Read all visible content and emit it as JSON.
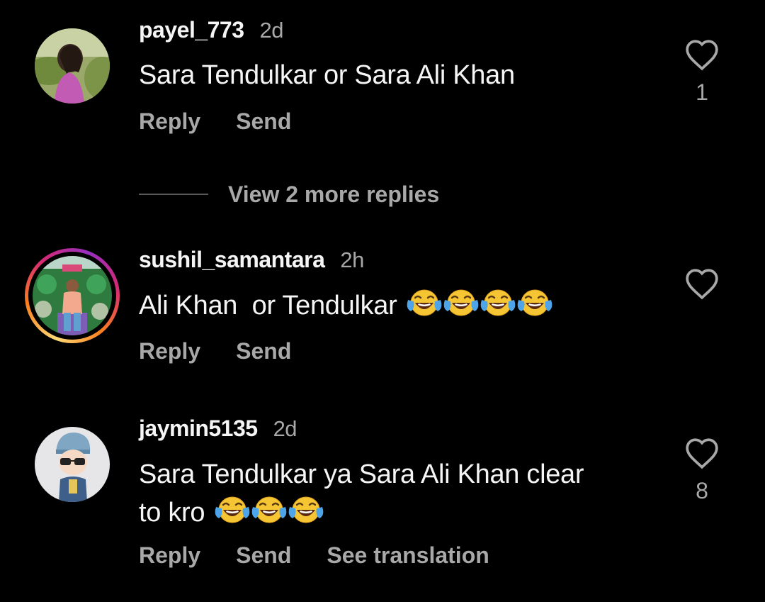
{
  "comments": [
    {
      "username": "payel_773",
      "time": "2d",
      "text": "Sara Tendulkar or Sara Ali Khan",
      "likes": "1",
      "reply_label": "Reply",
      "send_label": "Send"
    },
    {
      "username": "sushil_samantara",
      "time": "2h",
      "text": "Ali Khan  or Tendulkar",
      "emoji_count": 4,
      "reply_label": "Reply",
      "send_label": "Send"
    },
    {
      "username": "jaymin5135",
      "time": "2d",
      "text_line1": "Sara Tendulkar ya Sara Ali Khan clear",
      "text_line2": "to kro",
      "emoji_count": 3,
      "likes": "8",
      "reply_label": "Reply",
      "send_label": "Send",
      "translate_label": "See translation"
    }
  ],
  "view_replies_label": "View 2 more replies",
  "icons": {
    "like": "heart-outline-icon",
    "emoji": "face-with-tears-of-joy"
  },
  "colors": {
    "background": "#000000",
    "primary_text": "#f5f5f5",
    "secondary_text": "#a8a8a8"
  }
}
